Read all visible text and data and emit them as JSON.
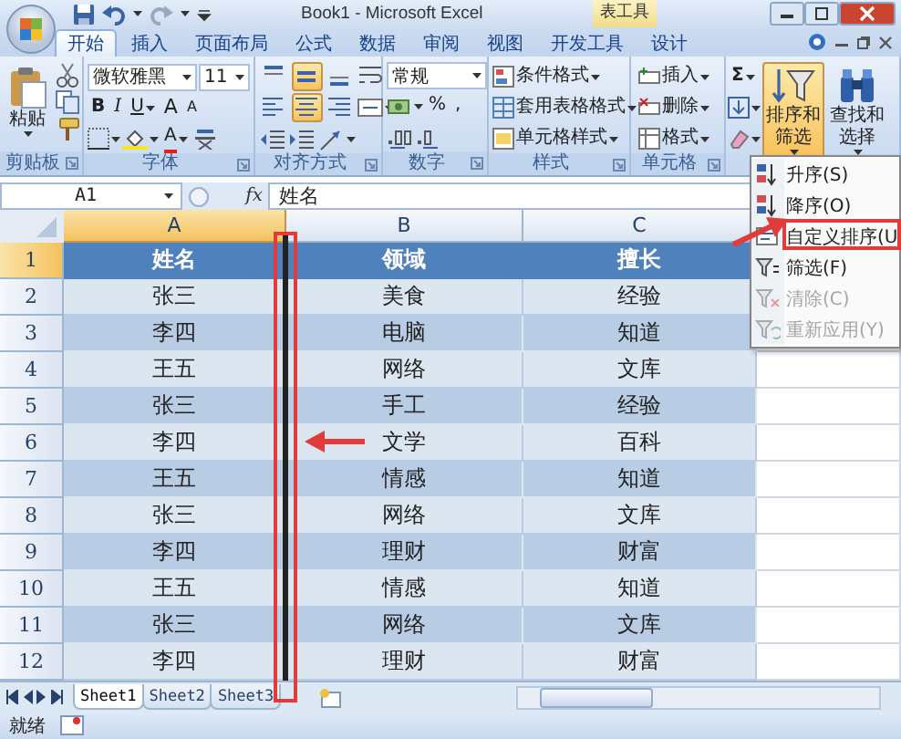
{
  "window": {
    "title": "Book1 - Microsoft Excel",
    "context_tab": "表工具"
  },
  "tabs": [
    {
      "label": "开始",
      "selected": true
    },
    {
      "label": "插入",
      "selected": false
    },
    {
      "label": "页面布局",
      "selected": false
    },
    {
      "label": "公式",
      "selected": false
    },
    {
      "label": "数据",
      "selected": false
    },
    {
      "label": "审阅",
      "selected": false
    },
    {
      "label": "视图",
      "selected": false
    },
    {
      "label": "开发工具",
      "selected": false
    },
    {
      "label": "设计",
      "selected": false
    }
  ],
  "ribbon": {
    "clipboard": {
      "label": "剪贴板",
      "paste": "粘贴"
    },
    "font": {
      "label": "字体",
      "name": "微软雅黑",
      "size": "11",
      "bold": "B",
      "italic": "I",
      "underline": "U",
      "grow": "A",
      "shrink": "A",
      "font_color_letter": "A"
    },
    "alignment": {
      "label": "对齐方式",
      "vertical": [
        {
          "selected": false
        },
        {
          "selected": true
        },
        {
          "selected": false
        }
      ],
      "horizontal": [
        {
          "selected": false
        },
        {
          "selected": true
        },
        {
          "selected": false
        }
      ]
    },
    "number": {
      "label": "数字",
      "format": "常规",
      "percent": "%",
      "comma": ","
    },
    "styles": {
      "label": "样式",
      "items": [
        "条件格式",
        "套用表格格式",
        "单元格样式"
      ]
    },
    "cells": {
      "label": "单元格",
      "items": [
        "插入",
        "删除",
        "格式"
      ]
    },
    "editing": {
      "autosum": "Σ",
      "sort_filter": {
        "label": "排序和筛选",
        "expanded": true
      },
      "find_select": "查找和选择"
    }
  },
  "formula_bar": {
    "name_box": "A1",
    "fx": "fx",
    "value": "姓名"
  },
  "sheet": {
    "columns": [
      {
        "label": "A",
        "selected": true
      },
      {
        "label": "B",
        "selected": false
      },
      {
        "label": "C",
        "selected": false
      }
    ],
    "rows": [
      {
        "number": "1",
        "selected": true,
        "kind": "header",
        "cells": [
          "姓名",
          "领域",
          "擅长"
        ]
      },
      {
        "number": "2",
        "selected": false,
        "kind": "data",
        "cells": [
          "张三",
          "美食",
          "经验"
        ]
      },
      {
        "number": "3",
        "selected": false,
        "kind": "data",
        "cells": [
          "李四",
          "电脑",
          "知道"
        ]
      },
      {
        "number": "4",
        "selected": false,
        "kind": "data",
        "cells": [
          "王五",
          "网络",
          "文库"
        ]
      },
      {
        "number": "5",
        "selected": false,
        "kind": "data",
        "cells": [
          "张三",
          "手工",
          "经验"
        ]
      },
      {
        "number": "6",
        "selected": false,
        "kind": "data",
        "cells": [
          "李四",
          "文学",
          "百科"
        ]
      },
      {
        "number": "7",
        "selected": false,
        "kind": "data",
        "cells": [
          "王五",
          "情感",
          "知道"
        ]
      },
      {
        "number": "8",
        "selected": false,
        "kind": "data",
        "cells": [
          "张三",
          "网络",
          "文库"
        ]
      },
      {
        "number": "9",
        "selected": false,
        "kind": "data",
        "cells": [
          "李四",
          "理财",
          "财富"
        ]
      },
      {
        "number": "10",
        "selected": false,
        "kind": "data",
        "cells": [
          "王五",
          "情感",
          "知道"
        ]
      },
      {
        "number": "11",
        "selected": false,
        "kind": "data",
        "cells": [
          "张三",
          "网络",
          "文库"
        ]
      },
      {
        "number": "12",
        "selected": false,
        "kind": "data",
        "cells": [
          "李四",
          "理财",
          "财富"
        ]
      }
    ]
  },
  "sheet_tabs": [
    {
      "label": "Sheet1",
      "selected": true
    },
    {
      "label": "Sheet2",
      "selected": false
    },
    {
      "label": "Sheet3",
      "selected": false
    }
  ],
  "status_bar": {
    "text": "就绪"
  },
  "sort_menu": [
    {
      "label": "升序(S)",
      "disabled": false
    },
    {
      "label": "降序(O)",
      "disabled": false
    },
    {
      "label": "自定义排序(U",
      "disabled": false
    },
    {
      "label": "筛选(F)",
      "disabled": false
    },
    {
      "label": "清除(C)",
      "disabled": true
    },
    {
      "label": "重新应用(Y)",
      "disabled": true
    }
  ]
}
